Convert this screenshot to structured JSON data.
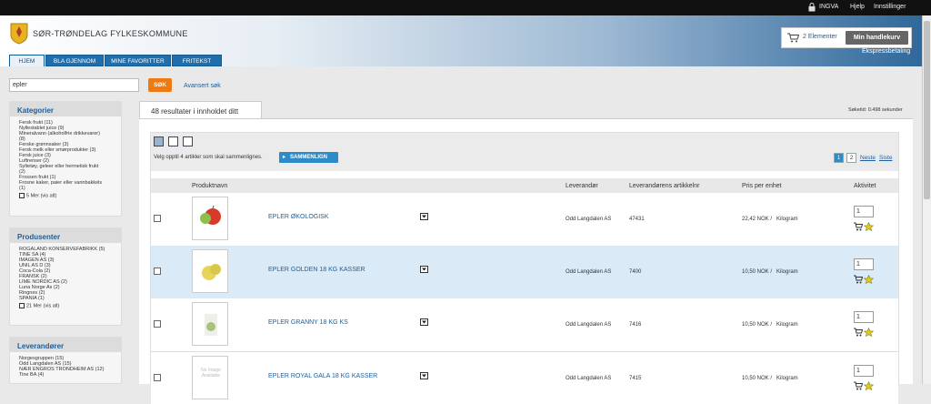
{
  "topbar": {
    "user": "INGVA",
    "help": "Hjelp",
    "settings": "Innstillinger"
  },
  "header": {
    "org_name": "SØR-TRØNDELAG FYLKESKOMMUNE",
    "cart_count": "2 Elementer",
    "cart_button": "Min handlekurv",
    "express": "Ekspressbetaling"
  },
  "tabs": [
    {
      "label": "HJEM"
    },
    {
      "label": "BLA GJENNOM"
    },
    {
      "label": "MINE FAVORITTER"
    },
    {
      "label": "FRITEKST"
    }
  ],
  "search": {
    "value": "epler",
    "button": "SØK",
    "advanced": "Avansert søk"
  },
  "sidebar": {
    "categories": {
      "title": "Kategorier",
      "items": [
        "Fersk frukt (11)",
        "Nyllestablet juice (9)",
        "Mineralvann (alkoholfrie drikkevarer)",
        "(8)",
        "Ferske grønnsaker (3)",
        "Fersk melk eller smørprodukter (3)",
        "Fersk juice (3)",
        "Luftrenser (2)",
        "Syltetøy, geleer eller hermetisk frukt",
        "(2)",
        "Frossen frukt (1)",
        "Frosne kaker, paier eller vannbakkels",
        "(1)"
      ],
      "more": "5 Mer (vis alt)"
    },
    "producers": {
      "title": "Produsenter",
      "items": [
        "ROGALAND KONSERVEFABRIKK (5)",
        "TINE SA (4)",
        "IMAGEN AS (3)",
        "UNIL AS D (3)",
        "Coca-Cola (2)",
        "FRANSK (2)",
        "LIME NORDIC AS (2)",
        "Luna Norge As (2)",
        "Ringnes (2)",
        "SPANIA (1)"
      ],
      "more": "21 Mer (vis alt)"
    },
    "suppliers": {
      "title": "Leverandører",
      "items": [
        "Norgesgruppen (15)",
        "Odd Langdalen AS (15)",
        "NÆR ENGROS TRONDHEIM AS (12)",
        "Tine BA (4)"
      ]
    }
  },
  "results": {
    "tab_label": "48 resultater i innholdet ditt",
    "search_time": "Søketid: 0.498 sekunder",
    "compare_text": "Velg opptil 4 artikler som skal sammenlignes.",
    "compare_button": "SAMMENLIGN",
    "pages": [
      "1",
      "2"
    ],
    "next": "Neste",
    "last": "Siste",
    "columns": {
      "product": "Produktnavn",
      "supplier": "Leverandør",
      "article": "Leverandørens artikkelnr",
      "price": "Pris per enhet",
      "activity": "Aktivitet"
    },
    "rows": [
      {
        "name": "EPLER ØKOLOGISK",
        "supplier": "Odd Langdalen AS",
        "article": "47431",
        "price": "22,42 NOK /",
        "unit": "Kilogram",
        "qty": "1",
        "image": "red-apple"
      },
      {
        "name": "EPLER GOLDEN 18 KG KASSER",
        "supplier": "Odd Langdalen AS",
        "article": "7400",
        "price": "10,50 NOK /",
        "unit": "Kilogram",
        "qty": "1",
        "image": "yellow-apples"
      },
      {
        "name": "EPLER GRANNY 18 KG KS",
        "supplier": "Odd Langdalen AS",
        "article": "7416",
        "price": "10,50 NOK /",
        "unit": "Kilogram",
        "qty": "1",
        "image": "green-apple"
      },
      {
        "name": "EPLER ROYAL GALA 18 KG KASSER",
        "supplier": "Odd Langdalen AS",
        "article": "7415",
        "price": "10,50 NOK /",
        "unit": "Kilogram",
        "qty": "1",
        "image": "no-image",
        "no_image_text": "No Image Available"
      }
    ]
  },
  "colors": {
    "brand_blue": "#1f6fae",
    "search_orange": "#f07a12",
    "row_highlight": "#dbeaf7",
    "link": "#1d5e9b"
  }
}
